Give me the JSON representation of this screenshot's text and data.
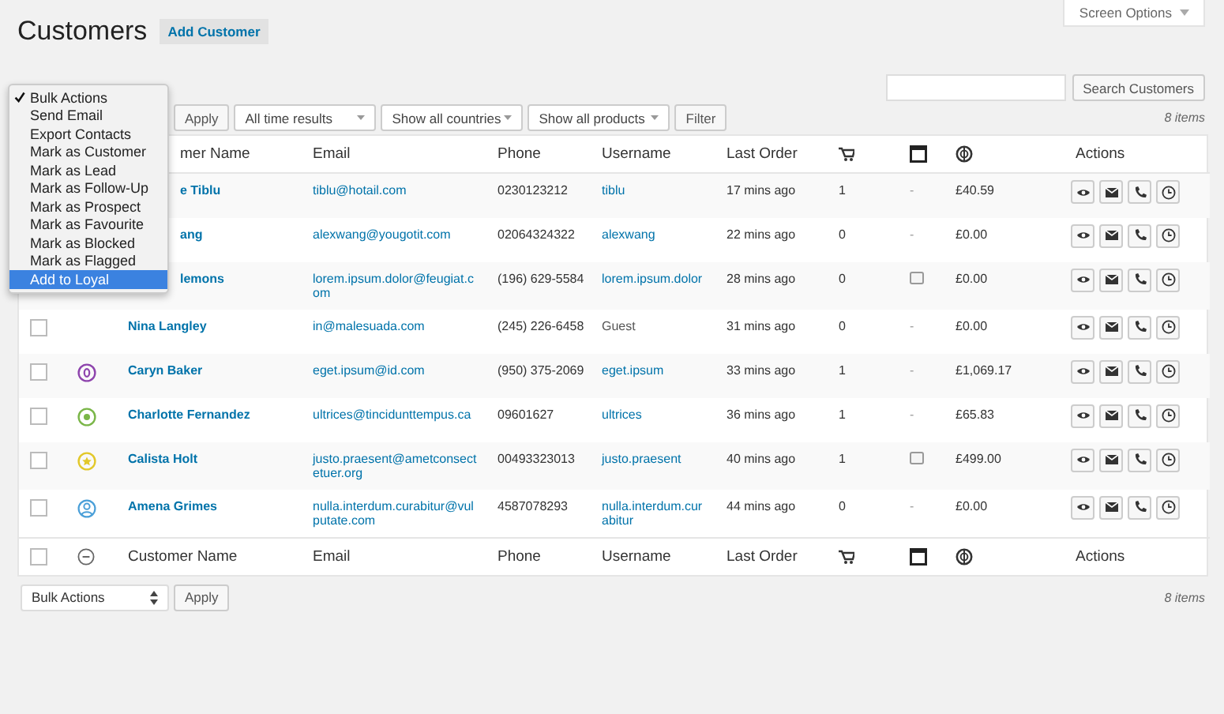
{
  "page": {
    "title": "Customers",
    "add_button": "Add Customer",
    "screen_options": "Screen Options"
  },
  "search": {
    "button": "Search Customers"
  },
  "filters": {
    "apply": "Apply",
    "selects": [
      "All time results",
      "Show all countries",
      "Show all products"
    ],
    "filter": "Filter",
    "count": "8 items"
  },
  "bulk_menu": {
    "items": [
      {
        "label": "Bulk Actions",
        "selected": true,
        "highlighted": false
      },
      {
        "label": "Send Email",
        "selected": false,
        "highlighted": false
      },
      {
        "label": "Export Contacts",
        "selected": false,
        "highlighted": false
      },
      {
        "label": "Mark as Customer",
        "selected": false,
        "highlighted": false
      },
      {
        "label": "Mark as Lead",
        "selected": false,
        "highlighted": false
      },
      {
        "label": "Mark as Follow-Up",
        "selected": false,
        "highlighted": false
      },
      {
        "label": "Mark as Prospect",
        "selected": false,
        "highlighted": false
      },
      {
        "label": "Mark as Favourite",
        "selected": false,
        "highlighted": false
      },
      {
        "label": "Mark as Blocked",
        "selected": false,
        "highlighted": false
      },
      {
        "label": "Mark as Flagged",
        "selected": false,
        "highlighted": false
      },
      {
        "label": "Add to Loyal",
        "selected": false,
        "highlighted": true
      }
    ]
  },
  "table": {
    "header": {
      "covered": true,
      "name": "mer Name",
      "email": "Email",
      "phone": "Phone",
      "username": "Username",
      "last_order": "Last Order",
      "actions": "Actions"
    },
    "rows": [
      {
        "covered": true,
        "name": "e Tiblu",
        "email": "tiblu@hotail.com",
        "phone": "0230123212",
        "username": "tiblu",
        "username_is_link": true,
        "last_order": "17 mins ago",
        "orders": "1",
        "screen": {
          "kind": "dash",
          "text": "-"
        },
        "total": "£40.59"
      },
      {
        "covered": true,
        "name": "ang",
        "email": "alexwang@yougotit.com",
        "phone": "02064324322",
        "username": "alexwang",
        "username_is_link": true,
        "last_order": "22 mins ago",
        "orders": "0",
        "screen": {
          "kind": "dash",
          "text": "-"
        },
        "total": "£0.00"
      },
      {
        "covered": true,
        "name": "lemons",
        "email": "lorem.ipsum.dolor@feugiat.com",
        "phone": "(196) 629-5584",
        "username": "lorem.ipsum.dolor",
        "username_is_link": true,
        "last_order": "28 mins ago",
        "orders": "0",
        "screen": {
          "kind": "box"
        },
        "total": "£0.00"
      },
      {
        "checked": false,
        "name": "Nina Langley",
        "email": "in@malesuada.com",
        "phone": "(245) 226-6458",
        "username": "Guest",
        "username_is_link": false,
        "last_order": "31 mins ago",
        "orders": "0",
        "screen": {
          "kind": "dash",
          "text": "-"
        },
        "total": "£0.00"
      },
      {
        "checked": false,
        "status": {
          "kind": "ring",
          "color": "#8e44ad"
        },
        "name": "Caryn Baker",
        "email": "eget.ipsum@id.com",
        "phone": "(950) 375-2069",
        "username": "eget.ipsum",
        "username_is_link": true,
        "last_order": "33 mins ago",
        "orders": "1",
        "screen": {
          "kind": "dash",
          "text": "-"
        },
        "total": "£1,069.17"
      },
      {
        "checked": false,
        "status": {
          "kind": "dot",
          "color": "#7ab648"
        },
        "name": "Charlotte Fernandez",
        "email": "ultrices@tincidunttempus.ca",
        "phone": "09601627",
        "username": "ultrices",
        "username_is_link": true,
        "last_order": "36 mins ago",
        "orders": "1",
        "screen": {
          "kind": "dash",
          "text": "-"
        },
        "total": "£65.83"
      },
      {
        "checked": false,
        "status": {
          "kind": "star",
          "color": "#e2c82a"
        },
        "name": "Calista Holt",
        "email": "justo.praesent@ametconsectetuer.org",
        "phone": "00493323013",
        "username": "justo.praesent",
        "username_is_link": true,
        "last_order": "40 mins ago",
        "orders": "1",
        "screen": {
          "kind": "box"
        },
        "total": "£499.00"
      },
      {
        "checked": false,
        "status": {
          "kind": "person",
          "color": "#4a9fd8"
        },
        "name": "Amena Grimes",
        "email": "nulla.interdum.curabitur@vulputate.com",
        "phone": "4587078293",
        "username": "nulla.interdum.curabitur",
        "username_is_link": true,
        "last_order": "44 mins ago",
        "orders": "0",
        "screen": {
          "kind": "dash",
          "text": "-"
        },
        "total": "£0.00"
      }
    ],
    "footer": {
      "checked": false,
      "name": "Customer Name",
      "email": "Email",
      "phone": "Phone",
      "username": "Username",
      "last_order": "Last Order",
      "actions": "Actions"
    }
  },
  "bottom": {
    "bulk_select": "Bulk Actions",
    "apply": "Apply",
    "count": "8 items"
  }
}
